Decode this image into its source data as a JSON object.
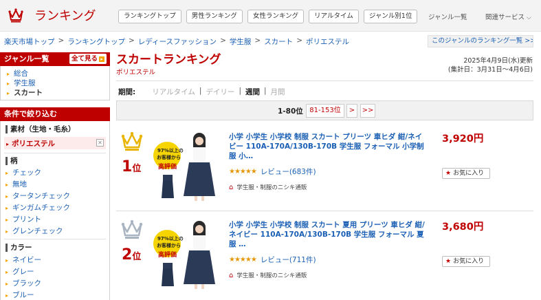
{
  "header": {
    "logo_text": "ランキング",
    "nav": [
      "ランキングトップ",
      "男性ランキング",
      "女性ランキング",
      "リアルタイム",
      "ジャンル別1位"
    ],
    "genre_list_link": "ジャンル一覧",
    "related_services": "関連サービス"
  },
  "breadcrumb": [
    "楽天市場トップ",
    "ランキングトップ",
    "レディースファッション",
    "学生服",
    "スカート",
    "ポリエステル"
  ],
  "genre_ranking_link": "このジャンルのランキング一覧 >>",
  "sidebar": {
    "genre_header": "ジャンル一覧",
    "see_all": "全て見る",
    "genres": [
      "総合",
      "学生服",
      "スカート"
    ],
    "filter_header": "条件で絞り込む",
    "material_title": "素材（生地・毛糸）",
    "material_selected": "ポリエステル",
    "pattern_title": "柄",
    "patterns": [
      "チェック",
      "無地",
      "タータンチェック",
      "ギンガムチェック",
      "プリント",
      "グレンチェック"
    ],
    "color_title": "カラー",
    "colors": [
      "ネイビー",
      "グレー",
      "ブラック",
      "ブルー"
    ]
  },
  "main": {
    "title": "スカートランキング",
    "subtitle": "ポリエステル",
    "updated": "2025年4月9日(水)更新",
    "period_range": "(集計日：3月31日〜4月6日)",
    "period_label": "期間:",
    "periods": [
      {
        "label": "リアルタイム",
        "active": false
      },
      {
        "label": "デイリー",
        "active": false
      },
      {
        "label": "週間",
        "active": true
      },
      {
        "label": "月間",
        "active": false
      }
    ]
  },
  "pager": {
    "current": "1-80位",
    "next_range": "81-153位",
    "next": ">",
    "last": ">>"
  },
  "items": [
    {
      "rank": "1",
      "rank_suffix": "位",
      "title": "小学 小学生 小学校 制服 スカート プリーツ 車ヒダ 紺/ネイビー 110A-170A/130B-170B 学生服 フォーマル 小学制服 小…",
      "stars": "★★★★★",
      "reviews": "レビュー(683件)",
      "shop": "学生服・制服のニシキ通販",
      "price": "3,920円",
      "fav": "お気に入り",
      "badge_line1": "97%以上の",
      "badge_line2": "お客様から",
      "badge_line3": "高評価",
      "crown_color": "#e8b400"
    },
    {
      "rank": "2",
      "rank_suffix": "位",
      "title": "小学 小学生 小学校 制服 スカート 夏用 プリーツ 車ヒダ 紺/ネイビー 110A-170A/130B-170B 学生服 フォーマル 夏服 …",
      "stars": "★★★★★",
      "reviews": "レビュー(711件)",
      "shop": "学生服・制服のニシキ通販",
      "price": "3,680円",
      "fav": "お気に入り",
      "badge_line1": "97%以上の",
      "badge_line2": "お客様から",
      "badge_line3": "高評価",
      "crown_color": "#a9b4c0"
    }
  ],
  "colors": {
    "brand_red": "#bf0000",
    "link_blue": "#1a5fb4",
    "star_orange": "#e69500"
  }
}
